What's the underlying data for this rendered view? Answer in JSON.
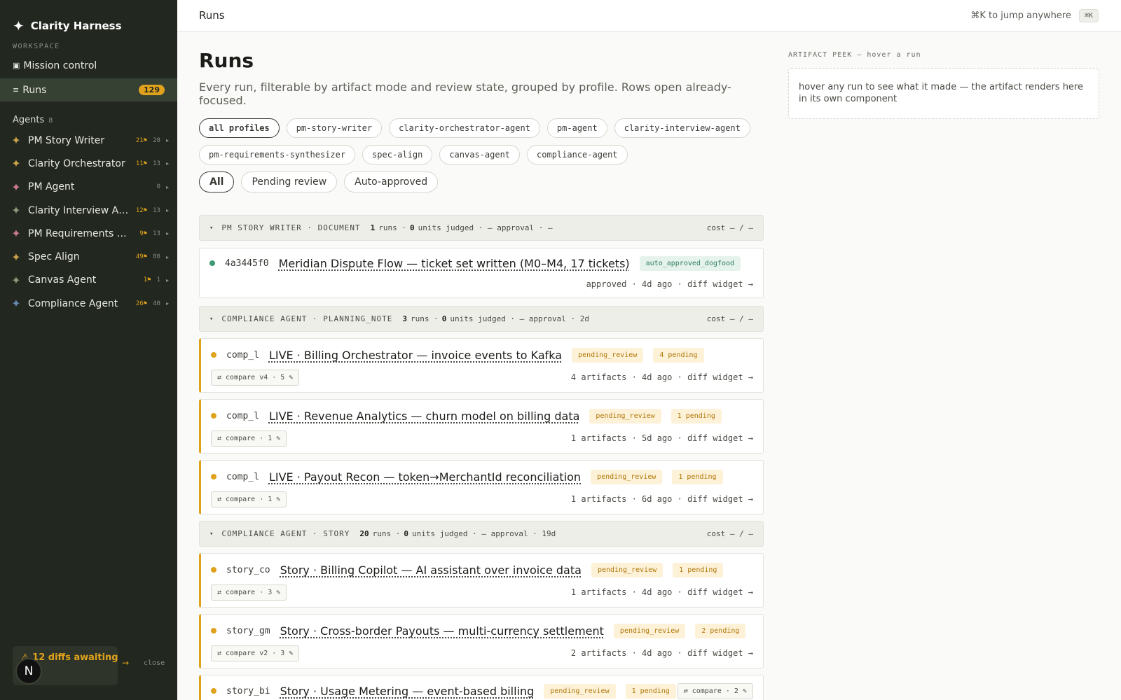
{
  "brand": {
    "icon": "sparkle-icon",
    "name": "Clarity Harness"
  },
  "sidebar": {
    "workspace_label": "WORKSPACE",
    "nav": [
      {
        "glyph": "▣",
        "icon": "grid-icon",
        "label": "Mission control"
      },
      {
        "glyph": "≡",
        "icon": "list-icon",
        "label": "Runs",
        "count": "129"
      }
    ],
    "agents_label": "Agents",
    "agents_count": "8",
    "agents": [
      {
        "name": "PM Story Writer",
        "judged": "21⚑",
        "runs": "28",
        "color": "#c9a14a"
      },
      {
        "name": "Clarity Orchestrator",
        "judged": "11⚑",
        "runs": "13",
        "color": "#c9a14a"
      },
      {
        "name": "PM Agent",
        "judged": "",
        "runs": "0",
        "color": "#c97a8c"
      },
      {
        "name": "Clarity Interview Agent",
        "judged": "12⚑",
        "runs": "13",
        "color": "#8a9a7a"
      },
      {
        "name": "PM Requirements Synthesizer",
        "judged": "9⚑",
        "runs": "13",
        "color": "#c97a8c"
      },
      {
        "name": "Spec Align",
        "judged": "49⚑",
        "runs": "80",
        "color": "#c9a14a"
      },
      {
        "name": "Canvas Agent",
        "judged": "1⚑",
        "runs": "1",
        "color": "#8a9a7a"
      },
      {
        "name": "Compliance Agent",
        "judged": "26⚑",
        "runs": "40",
        "color": "#6a86b5"
      }
    ],
    "diffs_text": "⚠ 12 diffs awaiting",
    "diffs_arrow": "→",
    "close_label": "close",
    "avatar_letter": "N"
  },
  "topbar": {
    "title": "Runs",
    "hint": "⌘K to jump anywhere",
    "kbd": "⌘K"
  },
  "main": {
    "title": "Runs",
    "subtitle": "Every run, filterable by artifact mode and review state, grouped by profile. Rows open already-focused.",
    "profiles": [
      "all profiles",
      "pm-story-writer",
      "clarity-orchestrator-agent",
      "pm-agent",
      "clarity-interview-agent",
      "pm-requirements-synthesizer",
      "spec-align",
      "canvas-agent",
      "compliance-agent"
    ],
    "states": [
      "All",
      "Pending review",
      "Auto-approved"
    ]
  },
  "groups": [
    {
      "caret": "▾",
      "title": "PM STORY WRITER · DOCUMENT",
      "runs_n": "1",
      "runs_label": "runs ·",
      "units_n": "0",
      "units_label": "units judged · — approval · —",
      "cost": "cost — / —"
    },
    {
      "caret": "▾",
      "title": "COMPLIANCE AGENT · PLANNING_NOTE",
      "runs_n": "3",
      "runs_label": "runs ·",
      "units_n": "0",
      "units_label": "units judged · — approval · 2d",
      "cost": "cost — / —"
    },
    {
      "caret": "▾",
      "title": "COMPLIANCE AGENT · STORY",
      "runs_n": "20",
      "runs_label": "runs ·",
      "units_n": "0",
      "units_label": "units judged · — approval · 19d",
      "cost": "cost — / —"
    }
  ],
  "runs": [
    {
      "id": "4a3445f0",
      "title": "Meridian Dispute Flow — ticket set written (M0–M4, 17 tickets)",
      "badge": "auto_approved_dogfood",
      "meta": "approved · 4d ago · diff widget →"
    },
    {
      "id": "comp_l",
      "title": "LIVE · Billing Orchestrator — invoice events to Kafka",
      "badge": "pending_review",
      "pending": "4 pending",
      "compare": "⇄ compare v4 · 5 ✎",
      "meta": "4 artifacts · 4d ago · diff widget →"
    },
    {
      "id": "comp_l",
      "title": "LIVE · Revenue Analytics — churn model on billing data",
      "badge": "pending_review",
      "pending": "1 pending",
      "compare": "⇄ compare · 1 ✎",
      "meta": "1 artifacts · 5d ago · diff widget →"
    },
    {
      "id": "comp_l",
      "title": "LIVE · Payout Recon — token→MerchantId reconciliation",
      "badge": "pending_review",
      "pending": "1 pending",
      "compare": "⇄ compare · 1 ✎",
      "meta": "1 artifacts · 6d ago · diff widget →"
    },
    {
      "id": "story_co",
      "title": "Story · Billing Copilot — AI assistant over invoice data",
      "badge": "pending_review",
      "pending": "1 pending",
      "compare": "⇄ compare · 3 ✎",
      "meta": "1 artifacts · 4d ago · diff widget →"
    },
    {
      "id": "story_gm",
      "title": "Story · Cross-border Payouts — multi-currency settlement",
      "badge": "pending_review",
      "pending": "2 pending",
      "compare": "⇄ compare v2 · 3 ✎",
      "meta": "2 artifacts · 4d ago · diff widget →"
    },
    {
      "id": "story_bi",
      "title": "Story · Usage Metering — event-based billing",
      "badge": "pending_review",
      "pending": "1 pending",
      "compare": "⇄ compare · 2 ✎",
      "meta": "1 artifacts · 5d ago · diff widget →"
    }
  ],
  "peek": {
    "label": "ARTIFACT PEEK — hover a run",
    "text": "hover any run to see what it made — the artifact renders here in its own component"
  },
  "colors": {
    "accent": "#e0a21c",
    "sidebar": "#22271f",
    "approved": "#3f9b74"
  }
}
